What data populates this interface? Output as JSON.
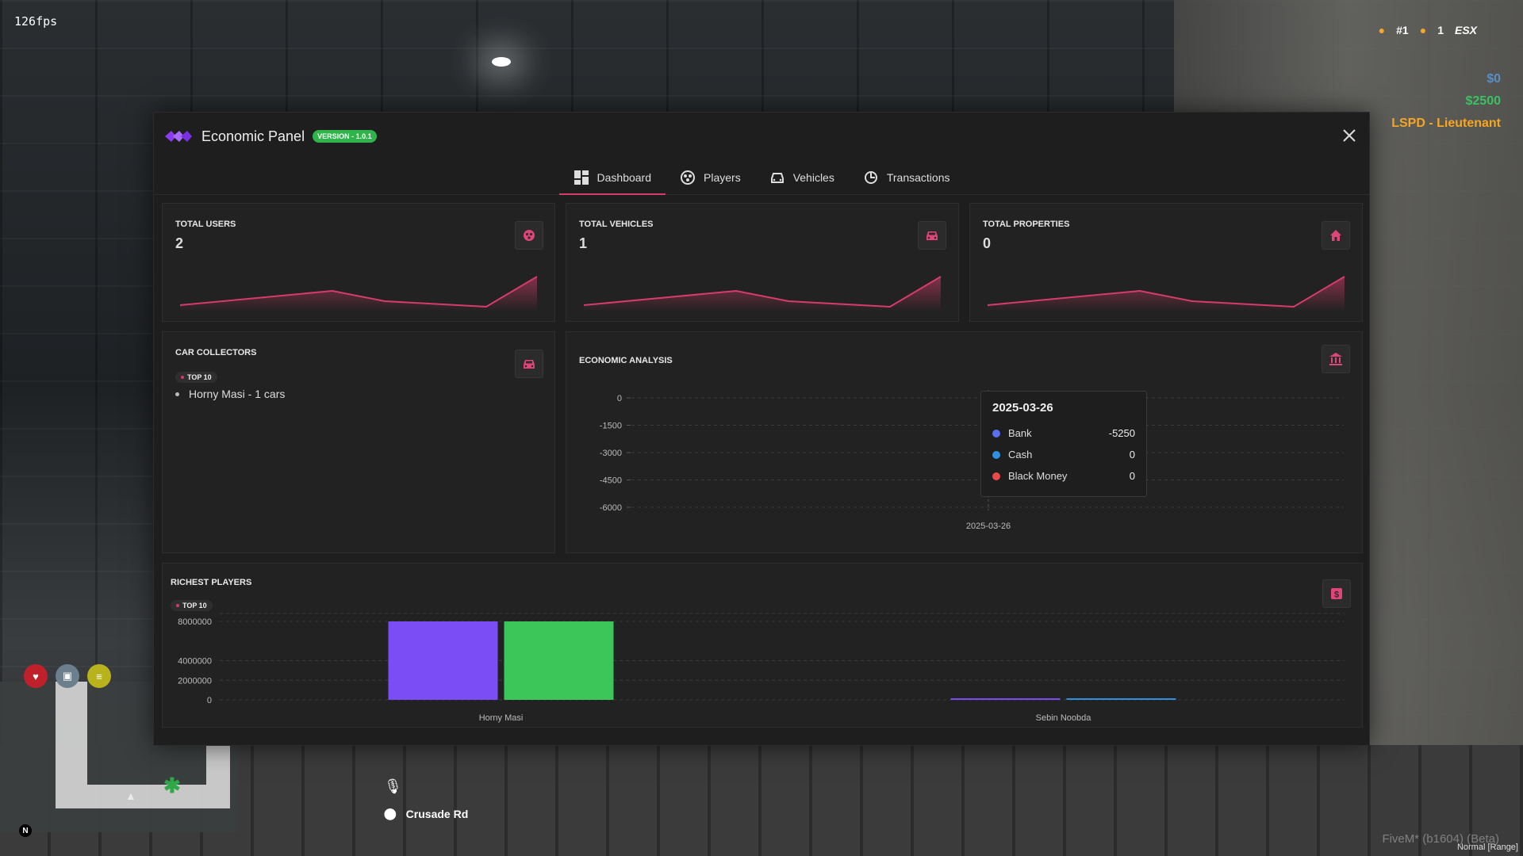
{
  "hud": {
    "fps": "126fps",
    "rank": "#1",
    "players_online": "1",
    "framework": "ESX",
    "bank": "$0",
    "cash": "$2500",
    "job": "LSPD - Lieutenant",
    "client_version": "FiveM* (b1604) (Beta)",
    "voice_mode": "Normal [Range]",
    "compass": "N",
    "street": "Crusade Rd"
  },
  "panel": {
    "title": "Economic Panel",
    "version": "VERSION - 1.0.1",
    "tabs": [
      {
        "label": "Dashboard",
        "icon": "dashboard-icon",
        "active": true
      },
      {
        "label": "Players",
        "icon": "players-icon",
        "active": false
      },
      {
        "label": "Vehicles",
        "icon": "car-icon",
        "active": false
      },
      {
        "label": "Transactions",
        "icon": "transactions-icon",
        "active": false
      }
    ],
    "stats": [
      {
        "title": "TOTAL USERS",
        "value": "2",
        "icon": "users-icon"
      },
      {
        "title": "TOTAL VEHICLES",
        "value": "1",
        "icon": "car-icon"
      },
      {
        "title": "TOTAL PROPERTIES",
        "value": "0",
        "icon": "house-icon"
      }
    ],
    "car_collectors": {
      "title": "CAR COLLECTORS",
      "badge": "TOP 10",
      "items": [
        "Horny Masi - 1 cars"
      ]
    },
    "economic_analysis": {
      "title": "ECONOMIC ANALYSIS",
      "tooltip": {
        "date": "2025-03-26",
        "rows": [
          {
            "label": "Bank",
            "value": "-5250",
            "color": "#5b6ef0"
          },
          {
            "label": "Cash",
            "value": "0",
            "color": "#2f8fe0"
          },
          {
            "label": "Black Money",
            "value": "0",
            "color": "#e84a4a"
          }
        ]
      }
    },
    "richest_players": {
      "title": "RICHEST PLAYERS",
      "badge": "TOP 10"
    }
  },
  "chart_data": [
    {
      "type": "line",
      "title": "ECONOMIC ANALYSIS",
      "x": [
        "2025-03-26"
      ],
      "yticks": [
        0,
        -1500,
        -3000,
        -4500,
        -6000
      ],
      "ylim": [
        -6000,
        0
      ],
      "series": [
        {
          "name": "Bank",
          "values": [
            -5250
          ],
          "color": "#5b6ef0"
        },
        {
          "name": "Cash",
          "values": [
            0
          ],
          "color": "#2f8fe0"
        },
        {
          "name": "Black Money",
          "values": [
            0
          ],
          "color": "#e84a4a"
        }
      ],
      "grid": true
    },
    {
      "type": "bar",
      "title": "RICHEST PLAYERS",
      "categories": [
        "Horny Masi",
        "Sebin Noobda"
      ],
      "yticks": [
        0,
        2000000,
        4000000,
        8000000
      ],
      "ylim": [
        0,
        8000000
      ],
      "series": [
        {
          "values": [
            8000000,
            30000
          ],
          "color": "#7b4ef5"
        },
        {
          "values": [
            8000000,
            30000
          ],
          "color": "#3cc65a"
        }
      ],
      "bar_colors": [
        "#7b4ef5",
        "#3cc65a",
        "#7b4ef5",
        "#2f8fe0"
      ],
      "grid": true
    }
  ]
}
